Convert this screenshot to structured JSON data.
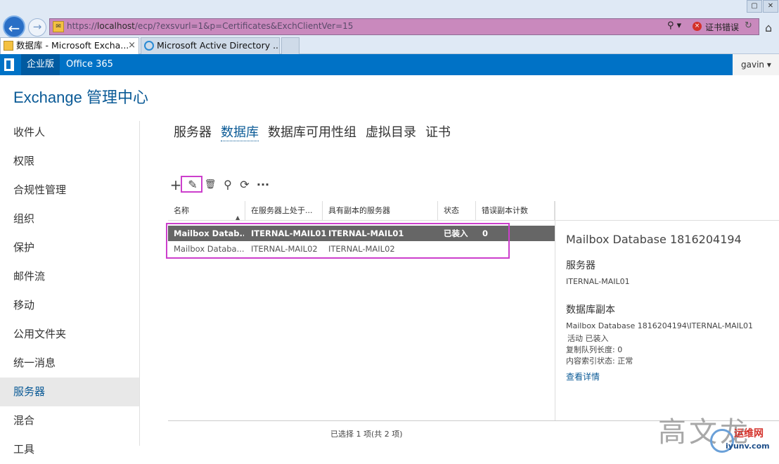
{
  "browser": {
    "url_prefix": "https://",
    "url_host": "localhost",
    "url_rest": "/ecp/?exsvurl=1&p=Certificates&ExchClientVer=15",
    "search_glyph": "⚲ ▾",
    "cert_error": "证书错误",
    "tabs": [
      {
        "label": "数据库 - Microsoft Excha...",
        "close": "×"
      },
      {
        "label": "Microsoft Active Directory ..."
      }
    ]
  },
  "o365_bar": {
    "edition": "企业版",
    "office": "Office 365",
    "user": "gavin ▾"
  },
  "app_title": "Exchange 管理中心",
  "leftnav": {
    "items": [
      "收件人",
      "权限",
      "合规性管理",
      "组织",
      "保护",
      "邮件流",
      "移动",
      "公用文件夹",
      "统一消息",
      "服务器",
      "混合",
      "工具"
    ],
    "active_index": 9
  },
  "page_tabs": [
    "服务器",
    "数据库",
    "数据库可用性组",
    "虚拟目录",
    "证书"
  ],
  "page_tab_active": 1,
  "toolbar": {
    "add": "+",
    "edit": "✎",
    "delete": "🗑",
    "search": "⚲",
    "refresh": "⟳",
    "more": "···"
  },
  "grid": {
    "columns": [
      "名称",
      "在服务器上处于...",
      "具有副本的服务器",
      "状态",
      "错误副本计数"
    ],
    "rows": [
      [
        "Mailbox Datab...",
        "ITERNAL-MAIL01",
        "ITERNAL-MAIL01",
        "已装入",
        "0"
      ],
      [
        "Mailbox Databa...",
        "ITERNAL-MAIL02",
        "ITERNAL-MAIL02",
        "",
        ""
      ]
    ],
    "status": "已选择 1 项(共 2 项)"
  },
  "detail": {
    "title": "Mailbox Database 1816204194",
    "server_heading": "服务器",
    "server": "ITERNAL-MAIL01",
    "copies_heading": "数据库副本",
    "copy_line1": "Mailbox Database 1816204194\\ITERNAL-MAIL01",
    "copy_line2": "活动 已装入",
    "copy_line3": "复制队列长度: 0",
    "copy_line4": "内容索引状态: 正常",
    "link": "查看详情"
  },
  "watermark": {
    "text": "高文龙",
    "brand": "运维网",
    "domain": "iyunv.com"
  },
  "colors": {
    "accent": "#0072c6",
    "title_blue": "#0a5a96",
    "highlight_box": "#cc3fcc",
    "selected_row": "#666666"
  }
}
